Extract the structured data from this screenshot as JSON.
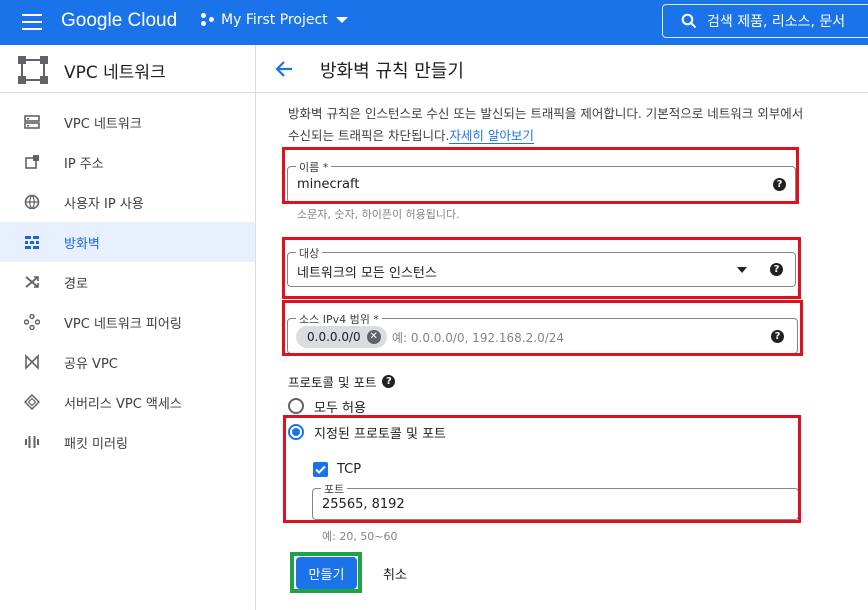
{
  "topbar": {
    "product_name": "Google Cloud",
    "project_name": "My First Project",
    "search_text": "검색   제품, 리소스, 문서"
  },
  "sidebar": {
    "title": "VPC 네트워크",
    "items": [
      {
        "label": "VPC 네트워크",
        "icon": "vpc-network-icon"
      },
      {
        "label": "IP 주소",
        "icon": "ip-address-icon"
      },
      {
        "label": "사용자 IP 사용",
        "icon": "globe-icon"
      },
      {
        "label": "방화벽",
        "icon": "firewall-icon",
        "active": true
      },
      {
        "label": "경로",
        "icon": "routes-icon"
      },
      {
        "label": "VPC 네트워크 피어링",
        "icon": "peering-icon"
      },
      {
        "label": "공유 VPC",
        "icon": "shared-vpc-icon"
      },
      {
        "label": "서버리스 VPC 액세스",
        "icon": "serverless-icon"
      },
      {
        "label": "패킷 미러링",
        "icon": "packet-mirroring-icon"
      }
    ]
  },
  "page": {
    "title": "방화벽 규칙 만들기"
  },
  "form": {
    "description": "방화벽 규칙은 인스턴스로 수신 또는 발신되는 트래픽을 제어합니다. 기본적으로 네트워크 외부에서 수신되는 트래픽은 차단됩니다.",
    "learn_more": "자세히 알아보기",
    "name_label": "이름 *",
    "name_value": "minecraft",
    "name_hint": "소문자, 숫자, 하이픈이 허용됩니다.",
    "target_label": "대상",
    "target_value": "네트워크의 모든 인스턴스",
    "source_label": "소스 IPv4 범위 *",
    "source_chip": "0.0.0.0/0",
    "source_placeholder": "예: 0.0.0.0/0, 192.168.2.0/24",
    "protocols_label": "프로토콜 및 포트",
    "radio_allow_all": "모두 허용",
    "radio_specified": "지정된 프로토콜 및 포트",
    "tcp_label": "TCP",
    "ports_label": "포트",
    "ports_value": "25565, 8192",
    "ports_hint": "예: 20, 50~60",
    "create_button": "만들기",
    "cancel_button": "취소"
  },
  "colors": {
    "brand_blue": "#1a73e8",
    "highlight_red": "#e0111f",
    "highlight_green": "#1ea446",
    "active_nav_bg": "#e8f0fe"
  }
}
